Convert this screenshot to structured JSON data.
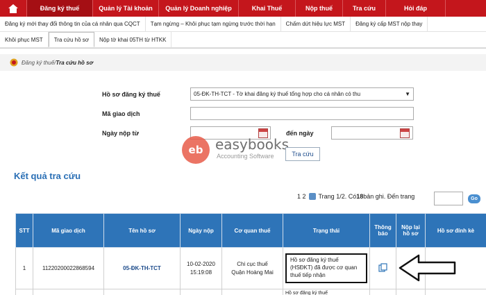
{
  "nav": {
    "items": [
      {
        "label": "Đăng ký thuế",
        "active": true
      },
      {
        "label": "Quản lý Tài khoản",
        "active": false
      },
      {
        "label": "Quản lý Doanh nghiệp",
        "active": false
      },
      {
        "label": "Khai Thuế",
        "active": false
      },
      {
        "label": "Nộp thuế",
        "active": false
      },
      {
        "label": "Tra cứu",
        "active": false
      },
      {
        "label": "Hỏi đáp",
        "active": false
      }
    ]
  },
  "subtabs": {
    "row1": [
      "Đăng ký mới thay đổi thông tin của cá nhân qua CQCT",
      "Tạm ngừng – Khôi phục tạm ngừng trước thời hạn",
      "Chấm dứt hiệu lực MST",
      "Đăng ký cấp MST nộp thay"
    ],
    "row2": [
      "Khôi phục MST",
      "Tra cứu hồ sơ",
      "Nộp tờ khai 05TH từ HTKK"
    ],
    "active": "Tra cứu hồ sơ"
  },
  "breadcrumb": {
    "parent": "Đăng ký thuế/",
    "current": " Tra cứu hồ sơ"
  },
  "form": {
    "ho_so_label": "Hồ sơ đăng ký thuế",
    "ho_so_value": "05-ĐK-TH-TCT - Tờ khai đăng ký thuế tổng hợp cho cá nhân có thu",
    "ma_gd_label": "Mã giao dịch",
    "ma_gd_value": "",
    "ngay_nop_tu_label": "Ngày nộp từ",
    "ngay_nop_tu_value": "",
    "den_ngay_label": "đến ngày",
    "den_ngay_value": "",
    "search_label": "Tra cứu"
  },
  "watermark": {
    "logo_text": "eb",
    "title": "easybooks",
    "subtitle": "Accounting Software"
  },
  "results": {
    "title": "Kết quả tra cứu",
    "pager_pages": "1 2",
    "pager_text_pre": "Trang 1/2. Có ",
    "pager_count": "18",
    "pager_text_post": " bản ghi. Đến trang",
    "go_label": "Go"
  },
  "table": {
    "headers": [
      "STT",
      "Mã giao dịch",
      "Tên hồ sơ",
      "Ngày nộp",
      "Cơ quan thuế",
      "Trạng thái",
      "Thông báo",
      "Nộp lại hồ sơ",
      "Hồ sơ đính kè"
    ],
    "rows": [
      {
        "stt": "1",
        "ma_gd": "11220200022868594",
        "ten_hs": "05-ĐK-TH-TCT",
        "ngay_nop_date": "10-02-2020",
        "ngay_nop_time": "15:19:08",
        "co_quan_1": "Chi cục thuế",
        "co_quan_2": "Quận Hoàng Mai",
        "trang_thai": "Hồ sơ đăng ký thuế (HSĐKT) đã được cơ quan thuế tiếp nhận"
      }
    ],
    "partial_row_text": "Hồ sơ đăng ký thuế"
  },
  "colors": {
    "nav_bg": "#c4161c",
    "table_header": "#2e74b8",
    "link": "#1b4a8a",
    "results_title": "#2a6fb5"
  }
}
